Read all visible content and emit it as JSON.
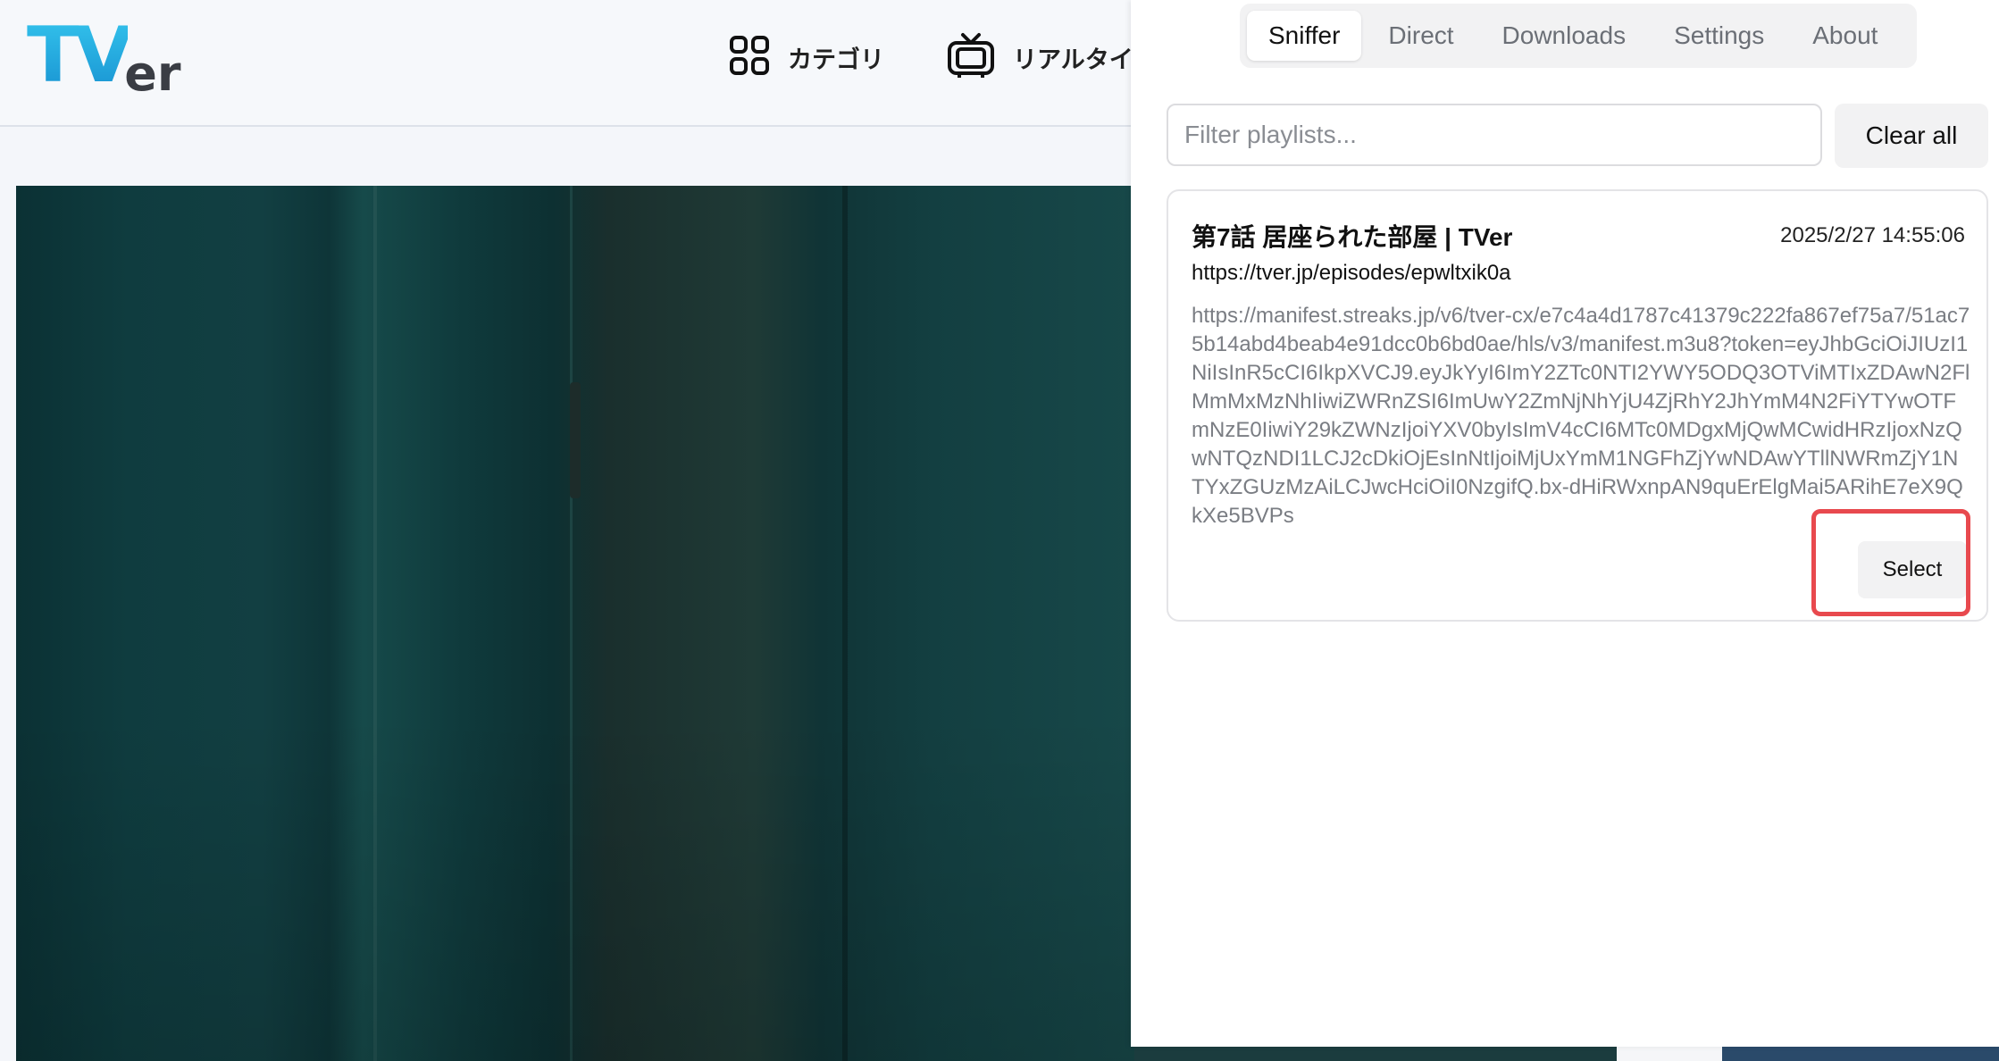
{
  "site": {
    "logo_main": "TV",
    "logo_sub": "er",
    "nav": [
      {
        "label": "カテゴリ",
        "icon": "grid-icon"
      },
      {
        "label": "リアルタイ",
        "icon": "tv-icon"
      }
    ]
  },
  "panel": {
    "tabs": [
      {
        "label": "Sniffer",
        "active": true
      },
      {
        "label": "Direct",
        "active": false
      },
      {
        "label": "Downloads",
        "active": false
      },
      {
        "label": "Settings",
        "active": false
      },
      {
        "label": "About",
        "active": false
      }
    ],
    "filter_placeholder": "Filter playlists...",
    "clear_label": "Clear all",
    "item": {
      "title": "第7話 居座られた部屋 | TVer",
      "date": "2025/2/27 14:55:06",
      "page_url": "https://tver.jp/episodes/epwltxik0a",
      "manifest_url": "https://manifest.streaks.jp/v6/tver-cx/e7c4a4d1787c41379c222fa867ef75a7/51ac75b14abd4beab4e91dcc0b6bd0ae/hls/v3/manifest.m3u8?token=eyJhbGciOiJIUzI1NiIsInR5cCI6IkpXVCJ9.eyJkYyI6ImY2ZTc0NTI2YWY5ODQ3OTViMTIxZDAwN2FlMmMxMzNhIiwiZWRnZSI6ImUwY2ZmNjNhYjU4ZjRhY2JhYmM4N2FiYTYwOTFmNzE0IiwiY29kZWNzIjoiYXV0byIsImV4cCI6MTc0MDgxMjQwMCwidHRzIjoxNzQwNTQzNDI1LCJ2cDkiOjEsInNtIjoiMjUxYmM1NGFhZjYwNDAwYTllNWRmZjY1NTYxZGUzMzAiLCJwcHciOiI0NzgifQ.bx-dHiRWxnpAN9quErElgMai5ARihE7eX9QkXe5BVPs",
      "select_label": "Select"
    },
    "highlight_color": "#e8494e"
  }
}
